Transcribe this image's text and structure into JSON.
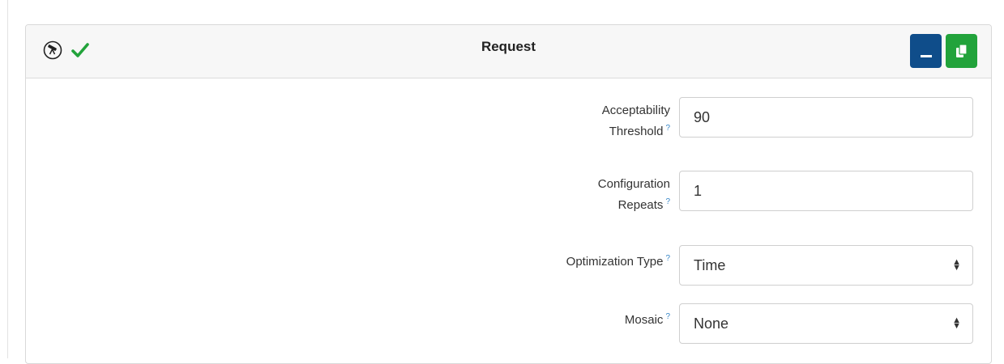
{
  "panel": {
    "title": "Request",
    "icons": [
      "telescope-icon",
      "check-icon"
    ],
    "buttons": [
      "collapse-button",
      "copy-button"
    ],
    "colors": {
      "collapse": "#0f4d8a",
      "copy": "#22a33b",
      "check": "#22a33b"
    }
  },
  "form": {
    "acceptability": {
      "label_line1": "Acceptability",
      "label_line2": "Threshold",
      "help": "?",
      "value": "90"
    },
    "repeats": {
      "label_line1": "Configuration",
      "label_line2": "Repeats",
      "help": "?",
      "value": "1"
    },
    "optimization": {
      "label": "Optimization Type",
      "help": "?",
      "value": "Time"
    },
    "mosaic": {
      "label": "Mosaic",
      "help": "?",
      "value": "None"
    }
  }
}
